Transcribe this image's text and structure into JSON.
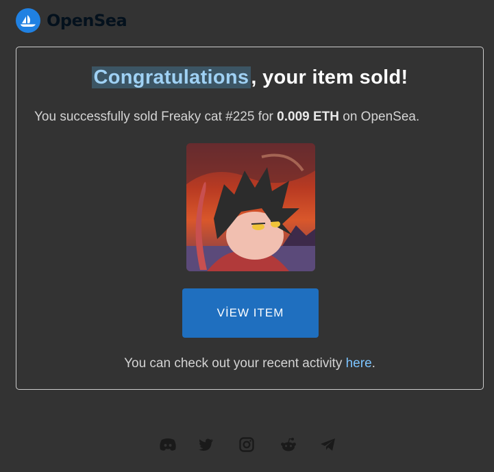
{
  "brand": {
    "name": "OpenSea",
    "logo_icon": "opensea-boat-icon",
    "accent": "#2081e2"
  },
  "email": {
    "title_highlight": "Congratulations",
    "title_rest": ", your item sold!",
    "message_prefix": "You successfully sold Freaky cat #225 for ",
    "price": "0.009 ETH",
    "message_suffix": " on OpenSea.",
    "item_image": "freaky-cat-nft-image",
    "button_label": "VİEW ITEM",
    "activity_prefix": "You can check out your recent activity ",
    "activity_link": "here",
    "activity_suffix": "."
  },
  "social": [
    "discord-icon",
    "twitter-icon",
    "instagram-icon",
    "reddit-icon",
    "telegram-icon"
  ],
  "colors": {
    "background": "#333333",
    "button": "#1f6fbf",
    "link": "#7cc4ff",
    "highlight_bg": "#3c5564"
  }
}
